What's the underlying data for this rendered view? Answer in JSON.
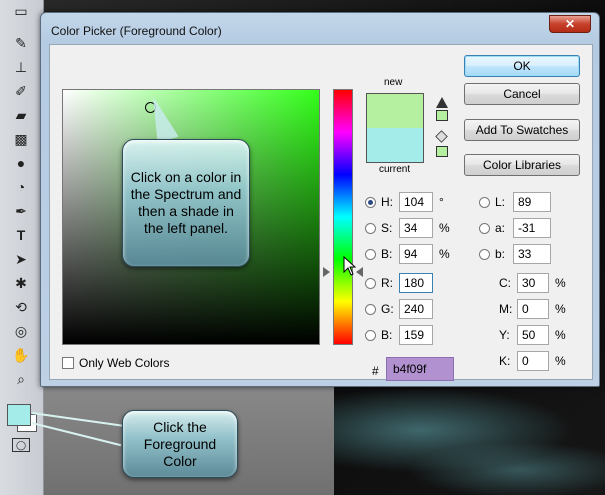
{
  "dialog": {
    "title": "Color Picker (Foreground Color)",
    "close_label": "✕"
  },
  "swatches": {
    "new_label": "new",
    "current_label": "current",
    "new_color": "#b4f09f",
    "current_color": "#a3ecea"
  },
  "buttons": {
    "ok": "OK",
    "cancel": "Cancel",
    "add_to_swatches": "Add To Swatches",
    "color_libraries": "Color Libraries"
  },
  "hsb": {
    "h": {
      "label": "H:",
      "value": "104",
      "unit": "°"
    },
    "s": {
      "label": "S:",
      "value": "34",
      "unit": "%"
    },
    "b": {
      "label": "B:",
      "value": "94",
      "unit": "%"
    }
  },
  "rgb": {
    "r": {
      "label": "R:",
      "value": "180"
    },
    "g": {
      "label": "G:",
      "value": "240"
    },
    "b": {
      "label": "B:",
      "value": "159"
    }
  },
  "lab": {
    "l": {
      "label": "L:",
      "value": "89"
    },
    "a": {
      "label": "a:",
      "value": "-31"
    },
    "b": {
      "label": "b:",
      "value": "33"
    }
  },
  "cmyk": {
    "c": {
      "label": "C:",
      "value": "30",
      "unit": "%"
    },
    "m": {
      "label": "M:",
      "value": "0",
      "unit": "%"
    },
    "y": {
      "label": "Y:",
      "value": "50",
      "unit": "%"
    },
    "k": {
      "label": "K:",
      "value": "0",
      "unit": "%"
    }
  },
  "hex": {
    "hash": "#",
    "value": "b4f09f"
  },
  "web_colors_label": "Only Web Colors",
  "callouts": {
    "spectrum": "Click on a color in the Spectrum and then a shade in the left panel.",
    "foreground": "Click the Foreground Color"
  },
  "tools": [
    "marquee-icon",
    "brush-icon",
    "stamp-icon",
    "history-brush-icon",
    "eraser-icon",
    "gradient-icon",
    "blur-icon",
    "dodge-icon",
    "pen-icon",
    "type-icon",
    "path-select-icon",
    "shape-icon",
    "3d-rotate-icon",
    "3d-orbit-icon",
    "hand-icon",
    "zoom-icon"
  ]
}
